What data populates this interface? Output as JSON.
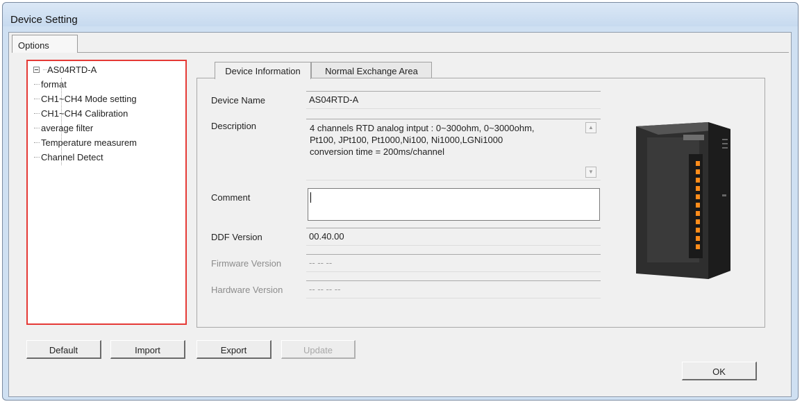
{
  "window": {
    "title": "Device Setting"
  },
  "options_tab": {
    "label": "Options"
  },
  "tree": {
    "root": "AS04RTD-A",
    "items": [
      "format",
      "CH1~CH4 Mode setting",
      "CH1~CH4 Calibration",
      "average filter",
      "Temperature measurem",
      "Channel Detect"
    ]
  },
  "tabs": [
    {
      "label": "Device Information",
      "active": true
    },
    {
      "label": "Normal Exchange Area",
      "active": false
    }
  ],
  "device_info": {
    "device_name_label": "Device Name",
    "device_name_value": "AS04RTD-A",
    "description_label": "Description",
    "description_lines": [
      "4 channels RTD analog intput : 0~300ohm, 0~3000ohm,",
      "Pt100, JPt100, Pt1000,Ni100, Ni1000,LGNi1000",
      "conversion time = 200ms/channel"
    ],
    "comment_label": "Comment",
    "comment_value": "",
    "ddf_version_label": "DDF Version",
    "ddf_version_value": "00.40.00",
    "firmware_version_label": "Firmware Version",
    "firmware_version_value": "-- -- --",
    "hardware_version_label": "Hardware Version",
    "hardware_version_value": "-- -- -- --"
  },
  "buttons": {
    "default": "Default",
    "import": "Import",
    "export": "Export",
    "update": "Update",
    "ok": "OK"
  },
  "colors": {
    "highlight_border": "#e53935",
    "window_frame": "#cfe0f2"
  }
}
